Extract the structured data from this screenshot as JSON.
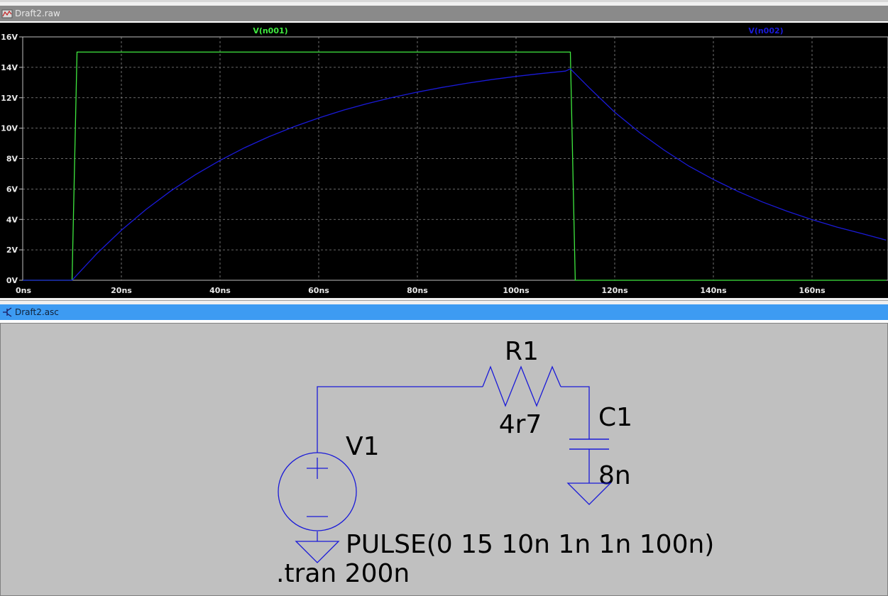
{
  "waveform_window": {
    "title": "Draft2.raw",
    "icon": "waveform-icon"
  },
  "schematic_window": {
    "title": "Draft2.asc",
    "icon": "schematic-icon"
  },
  "colors": {
    "plot_bg": "#000000",
    "grid": "#8a8a8a",
    "trace_v_n001": "#3fe83f",
    "trace_v_n002": "#1a1ad8",
    "schematic_bg": "#c0c0c0",
    "wire": "#1a1ad8",
    "label_text": "#000000"
  },
  "chart_data": {
    "type": "line",
    "series": [
      {
        "name": "V(n001)",
        "x": [
          0,
          10,
          11,
          111,
          112,
          175
        ],
        "values": [
          0,
          0,
          15,
          15,
          0,
          0
        ]
      },
      {
        "name": "V(n002)",
        "x": [
          0,
          10,
          15,
          20,
          25,
          30,
          35,
          40,
          45,
          50,
          55,
          60,
          65,
          70,
          75,
          80,
          85,
          90,
          95,
          100,
          105,
          110,
          111,
          115,
          120,
          125,
          130,
          135,
          140,
          145,
          150,
          155,
          160,
          165,
          170,
          175
        ],
        "values": [
          0,
          0,
          1.75,
          3.29,
          4.66,
          5.87,
          6.94,
          7.88,
          8.72,
          9.45,
          10.1,
          10.67,
          11.18,
          11.63,
          12.02,
          12.37,
          12.68,
          12.95,
          13.19,
          13.4,
          13.59,
          13.75,
          13.9,
          12.6,
          11.05,
          9.72,
          8.56,
          7.51,
          6.63,
          5.84,
          5.14,
          4.53,
          3.99,
          3.5,
          3.08,
          2.64
        ]
      }
    ],
    "xlim": [
      0,
      175
    ],
    "ylim": [
      0,
      16
    ],
    "x_ticks": [
      0,
      20,
      40,
      60,
      80,
      100,
      120,
      140,
      160
    ],
    "y_ticks": [
      0,
      2,
      4,
      6,
      8,
      10,
      12,
      14,
      16
    ],
    "x_tick_labels": [
      "0ns",
      "20ns",
      "40ns",
      "60ns",
      "80ns",
      "100ns",
      "120ns",
      "140ns",
      "160ns"
    ],
    "y_tick_labels": [
      "0V",
      "2V",
      "4V",
      "6V",
      "8V",
      "10V",
      "12V",
      "14V",
      "16V"
    ],
    "grid": true,
    "legend": "top"
  },
  "schematic": {
    "resistor": {
      "ref": "R1",
      "value": "4r7"
    },
    "capacitor": {
      "ref": "C1",
      "value": "8n"
    },
    "source": {
      "ref": "V1",
      "value": "PULSE(0 15 10n 1n 1n 100n)"
    },
    "directive": ".tran 200n"
  }
}
